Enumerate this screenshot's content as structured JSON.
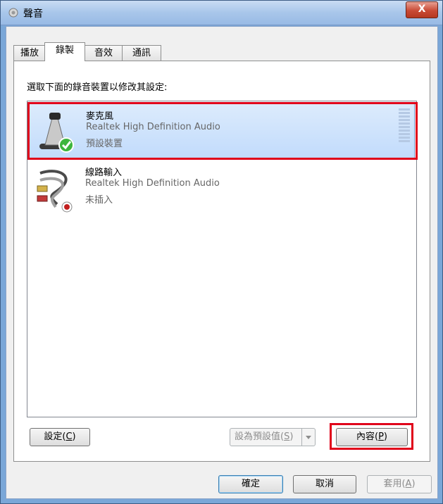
{
  "window": {
    "title": "聲音",
    "close_label": "X"
  },
  "tabs": [
    {
      "label": "播放"
    },
    {
      "label": "錄製"
    },
    {
      "label": "音效"
    },
    {
      "label": "通訊"
    }
  ],
  "instruction": "選取下面的錄音裝置以修改其設定:",
  "devices": [
    {
      "name": "麥克風",
      "driver": "Realtek High Definition Audio",
      "status": "預設裝置",
      "selected": true
    },
    {
      "name": "線路輸入",
      "driver": "Realtek High Definition Audio",
      "status": "未插入",
      "selected": false
    }
  ],
  "buttons": {
    "configure": {
      "label": "設定",
      "key": "C"
    },
    "set_default": {
      "label": "設為預設值",
      "key": "S"
    },
    "properties": {
      "label": "內容",
      "key": "P"
    },
    "ok": "確定",
    "cancel": "取消",
    "apply": {
      "label": "套用",
      "key": "A"
    }
  },
  "colors": {
    "highlight": "#e0001a",
    "selection": "#c1dbfc",
    "accent": "#3c7fb1"
  }
}
